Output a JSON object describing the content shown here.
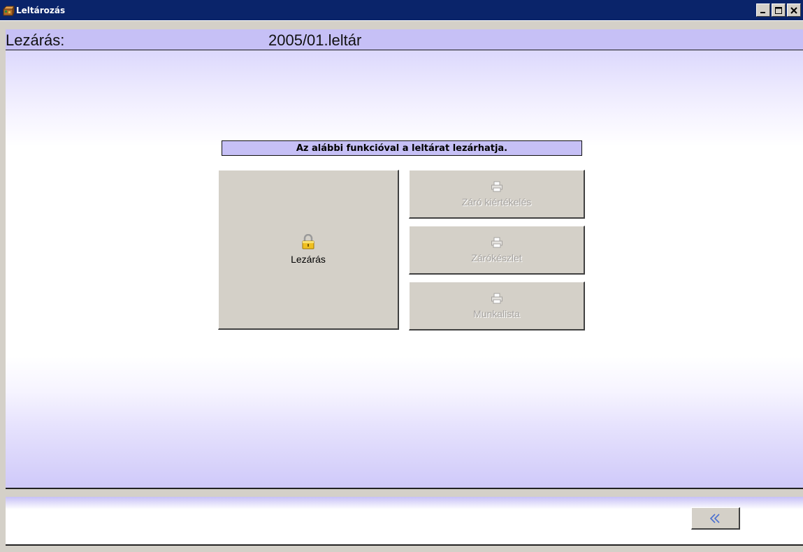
{
  "window": {
    "title": "Leltározás",
    "app_icon": "inventory-box-icon",
    "controls": [
      "minimize-icon",
      "maximize-icon",
      "close-icon"
    ]
  },
  "header": {
    "label": "Lezárás:",
    "value": "2005/01.leltár"
  },
  "main": {
    "message": "Az alábbi funkcióval a leltárat lezárhatja.",
    "buttons": {
      "lock": {
        "label": "Lezárás",
        "icon": "padlock-icon",
        "enabled": true
      },
      "zaro_kiertekeles": {
        "label": "Záró kiértékelés",
        "icon": "printer-icon",
        "enabled": false
      },
      "zarokeszlet": {
        "label": "Zárókészlet",
        "icon": "printer-icon",
        "enabled": false
      },
      "munkalista": {
        "label": "Munkalista",
        "icon": "printer-icon",
        "enabled": false
      }
    }
  },
  "footer": {
    "back_icon": "rewind-back-icon"
  },
  "colors": {
    "titlebar": "#0a246a",
    "accent_lavender": "#c6c0f6",
    "button_face": "#d4d0c8",
    "back_arrow": "#4a6fd0"
  }
}
